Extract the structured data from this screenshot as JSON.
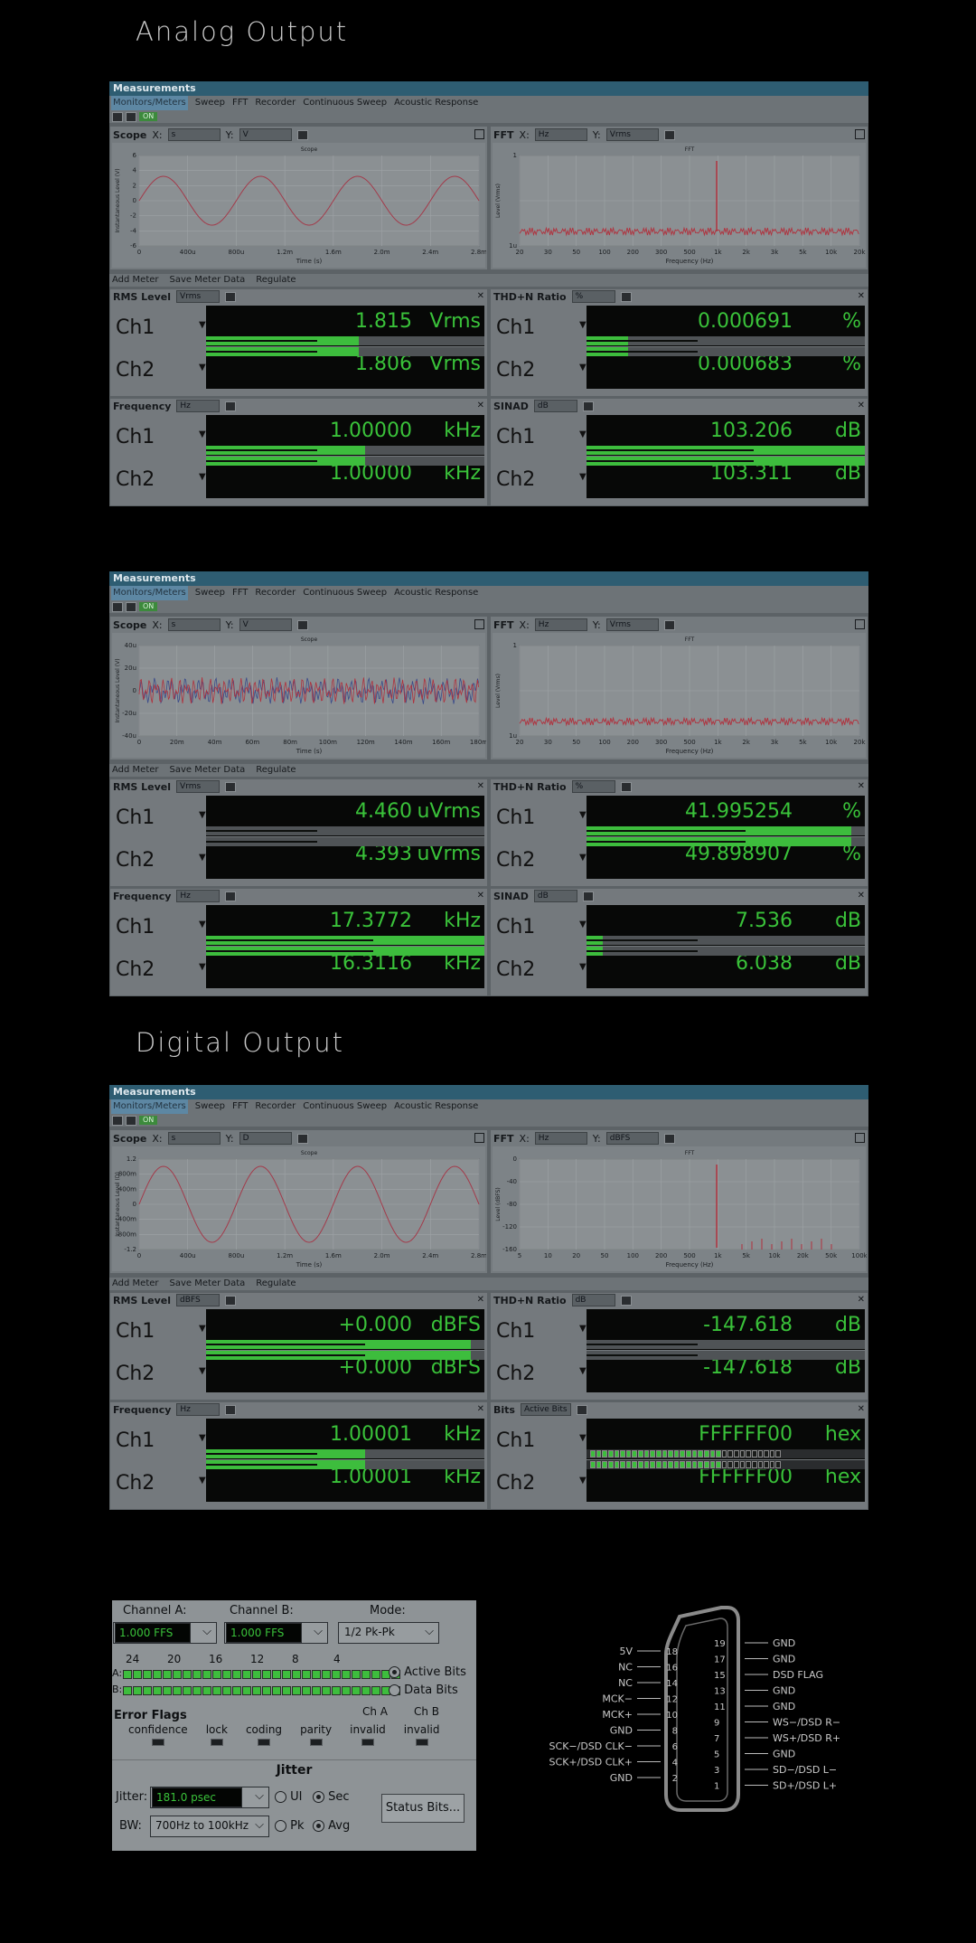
{
  "sections": {
    "analog": "Analog Output",
    "digital": "Digital Output"
  },
  "colors": {
    "green": "#3ac23a",
    "trace_red": "#b0313d",
    "trace_blue": "#3a4a8a",
    "titlebar": "#2e5d72"
  },
  "window": {
    "title": "Measurements",
    "tabs": [
      "Monitors/Meters",
      "Sweep",
      "FFT",
      "Recorder",
      "Continuous Sweep",
      "Acoustic Response"
    ],
    "on_label": "ON",
    "meter_toolbar": [
      "Add Meter",
      "Save Meter Data",
      "Regulate"
    ]
  },
  "panels": [
    {
      "scope": {
        "title": "Scope",
        "x_label": "X:",
        "x_unit": "s",
        "y_label": "Y:",
        "y_unit": "V",
        "plot_title": "Scope",
        "ylabel": "Instantaneous Level (V)",
        "xlabel": "Time (s)",
        "yticks": [
          "6",
          "4",
          "2",
          "0",
          "-2",
          "-4",
          "-6"
        ],
        "xticks": [
          "0",
          "400u",
          "800u",
          "1.2m",
          "1.6m",
          "2.0m",
          "2.4m",
          "2.8m"
        ]
      },
      "fft": {
        "title": "FFT",
        "x_label": "X:",
        "x_unit": "Hz",
        "y_label": "Y:",
        "y_unit": "Vrms",
        "plot_title": "FFT",
        "ylabel": "Level (Vrms)",
        "xlabel": "Frequency (Hz)",
        "yticks": [
          "1",
          "",
          "1u"
        ],
        "xticks": [
          "20",
          "30",
          "50",
          "100",
          "200",
          "300",
          "500",
          "1k",
          "2k",
          "3k",
          "5k",
          "10k",
          "20k"
        ]
      },
      "meters": [
        {
          "title": "RMS Level",
          "unit_sel": "Vrms",
          "ch1": "1.815",
          "ch2": "1.806",
          "unit": "Vrms",
          "bar1": 0.55,
          "bar2": 0.55
        },
        {
          "title": "THD+N Ratio",
          "unit_sel": "%",
          "ch1": "0.000691",
          "ch2": "0.000683",
          "unit": "%",
          "bar1": 0.15,
          "bar2": 0.15
        },
        {
          "title": "Frequency",
          "unit_sel": "Hz",
          "ch1": "1.00000",
          "ch2": "1.00000",
          "unit": "kHz",
          "bar1": 0.57,
          "bar2": 0.57
        },
        {
          "title": "SINAD",
          "unit_sel": "dB",
          "ch1": "103.206",
          "ch2": "103.311",
          "unit": "dB",
          "bar1": 1.0,
          "bar2": 1.0
        }
      ]
    },
    {
      "scope": {
        "title": "Scope",
        "x_label": "X:",
        "x_unit": "s",
        "y_label": "Y:",
        "y_unit": "V",
        "plot_title": "Scope",
        "ylabel": "Instantaneous Level (V)",
        "xlabel": "Time (s)",
        "yticks": [
          "40u",
          "20u",
          "0",
          "-20u",
          "-40u"
        ],
        "xticks": [
          "0",
          "20m",
          "40m",
          "60m",
          "80m",
          "100m",
          "120m",
          "140m",
          "160m",
          "180m"
        ]
      },
      "fft": {
        "title": "FFT",
        "x_label": "X:",
        "x_unit": "Hz",
        "y_label": "Y:",
        "y_unit": "Vrms",
        "plot_title": "FFT",
        "ylabel": "Level (Vrms)",
        "xlabel": "Frequency (Hz)",
        "yticks": [
          "1",
          "",
          "1u"
        ],
        "xticks": [
          "20",
          "30",
          "50",
          "100",
          "200",
          "300",
          "500",
          "1k",
          "2k",
          "3k",
          "5k",
          "10k",
          "20k"
        ]
      },
      "meters": [
        {
          "title": "RMS Level",
          "unit_sel": "Vrms",
          "ch1": "4.460",
          "ch2": "4.393",
          "unit": "uVrms",
          "bar1": 0.0,
          "bar2": 0.0
        },
        {
          "title": "THD+N Ratio",
          "unit_sel": "%",
          "ch1": "41.995254",
          "ch2": "49.898907",
          "unit": "%",
          "bar1": 0.95,
          "bar2": 0.95
        },
        {
          "title": "Frequency",
          "unit_sel": "Hz",
          "ch1": "17.3772",
          "ch2": "16.3116",
          "unit": "kHz",
          "bar1": 1.0,
          "bar2": 1.0
        },
        {
          "title": "SINAD",
          "unit_sel": "dB",
          "ch1": "7.536",
          "ch2": "6.038",
          "unit": "dB",
          "bar1": 0.06,
          "bar2": 0.06
        }
      ]
    },
    {
      "scope": {
        "title": "Scope",
        "x_label": "X:",
        "x_unit": "s",
        "y_label": "Y:",
        "y_unit": "D",
        "plot_title": "Scope",
        "ylabel": "Instantaneous Level (D)",
        "xlabel": "Time (s)",
        "yticks": [
          "1.2",
          "800m",
          "400m",
          "0",
          "-400m",
          "-800m",
          "-1.2"
        ],
        "xticks": [
          "0",
          "400u",
          "800u",
          "1.2m",
          "1.6m",
          "2.0m",
          "2.4m",
          "2.8m"
        ]
      },
      "fft": {
        "title": "FFT",
        "x_label": "X:",
        "x_unit": "Hz",
        "y_label": "Y:",
        "y_unit": "dBFS",
        "plot_title": "FFT",
        "ylabel": "Level (dBFS)",
        "xlabel": "Frequency (Hz)",
        "yticks": [
          "0",
          "-40",
          "-80",
          "-120",
          "-160"
        ],
        "xticks": [
          "5",
          "10",
          "20",
          "50",
          "100",
          "200",
          "500",
          "1k",
          "5k",
          "10k",
          "20k",
          "50k",
          "100k"
        ]
      },
      "meters": [
        {
          "title": "RMS Level",
          "unit_sel": "dBFS",
          "ch1": "+0.000",
          "ch2": "+0.000",
          "unit": "dBFS",
          "bar1": 0.95,
          "bar2": 0.95
        },
        {
          "title": "THD+N Ratio",
          "unit_sel": "dB",
          "ch1": "-147.618",
          "ch2": "-147.618",
          "unit": "dB",
          "bar1": 0.0,
          "bar2": 0.0
        },
        {
          "title": "Frequency",
          "unit_sel": "Hz",
          "ch1": "1.00001",
          "ch2": "1.00001",
          "unit": "kHz",
          "bar1": 0.57,
          "bar2": 0.57
        },
        {
          "title": "Bits",
          "unit_sel": "Active Bits",
          "ch1": "FFFFFF00",
          "ch2": "FFFFFF00",
          "unit": "hex",
          "bar1": 0.7,
          "bar2": 0.7,
          "bits": true
        }
      ]
    }
  ],
  "status_panel": {
    "channel_a_label": "Channel A:",
    "channel_a_value": "1.000   FFS",
    "channel_b_label": "Channel B:",
    "channel_b_value": "1.000   FFS",
    "mode_label": "Mode:",
    "mode_value": "1/2 Pk-Pk",
    "bit_numbers": [
      "24",
      "20",
      "16",
      "12",
      "8",
      "4"
    ],
    "row_a": "A:",
    "row_b": "B:",
    "active_bits": "Active Bits",
    "data_bits": "Data Bits",
    "error_flags": "Error Flags",
    "flags": [
      "confidence",
      "lock",
      "coding",
      "parity",
      "invalid",
      "invalid"
    ],
    "cha": "Ch A",
    "chb": "Ch B",
    "jitter_title": "Jitter",
    "jitter_label": "Jitter:",
    "jitter_value": "181.0   psec",
    "ui": "UI",
    "sec": "Sec",
    "bw_label": "BW:",
    "bw_value": "700Hz to 100kHz",
    "pk": "Pk",
    "avg": "Avg",
    "status_bits": "Status Bits..."
  },
  "connector": {
    "left_labels": [
      "5V",
      "NC",
      "NC",
      "MCK−",
      "MCK+",
      "GND",
      "SCK−/DSD CLK−",
      "SCK+/DSD CLK+",
      "GND"
    ],
    "left_pins": [
      "18",
      "16",
      "14",
      "12",
      "10",
      "8",
      "6",
      "4",
      "2"
    ],
    "right_pins": [
      "19",
      "17",
      "15",
      "13",
      "11",
      "9",
      "7",
      "5",
      "3",
      "1"
    ],
    "right_labels": [
      "GND",
      "GND",
      "DSD FLAG",
      "GND",
      "GND",
      "WS−/DSD R−",
      "WS+/DSD R+",
      "GND",
      "SD−/DSD L−",
      "SD+/DSD L+"
    ]
  }
}
